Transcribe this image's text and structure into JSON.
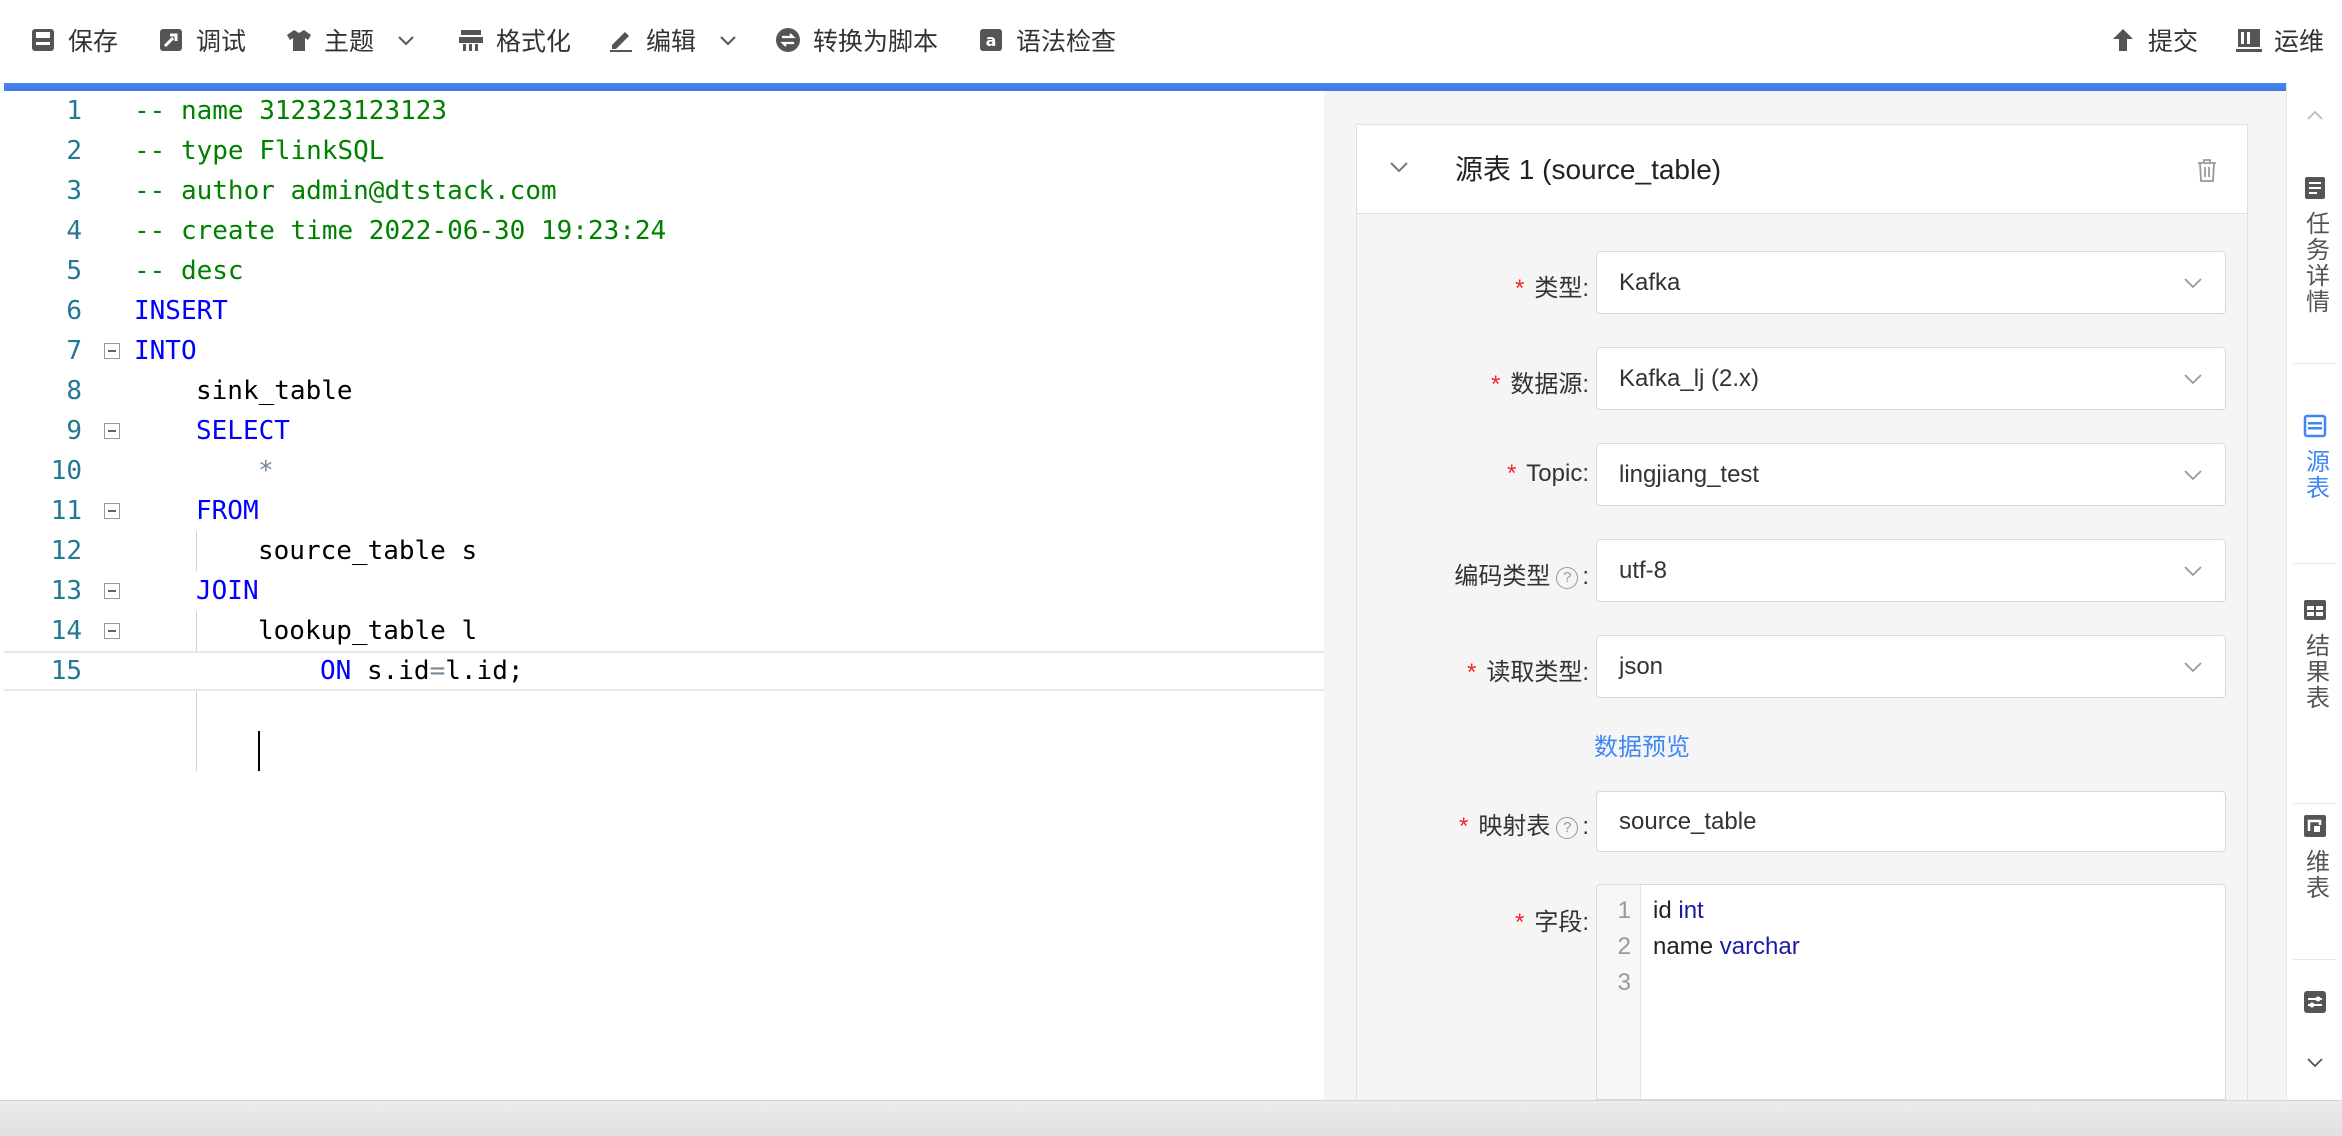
{
  "toolbar": {
    "save": "保存",
    "debug": "调试",
    "theme": "主题",
    "format": "格式化",
    "edit": "编辑",
    "convert": "转换为脚本",
    "syntax_check": "语法检查",
    "submit": "提交",
    "ops": "运维"
  },
  "editor": {
    "lines": [
      "-- name 312323123123",
      "-- type FlinkSQL",
      "-- author admin@dtstack.com",
      "-- create time 2022-06-30 19:23:24",
      "-- desc",
      "INSERT",
      "INTO",
      "sink_table",
      "SELECT",
      "*",
      "FROM",
      "source_table s",
      "JOIN",
      "lookup_table l",
      "ON",
      "s.id",
      "=",
      "l.id;"
    ],
    "line_numbers": [
      "1",
      "2",
      "3",
      "4",
      "5",
      "6",
      "7",
      "8",
      "9",
      "10",
      "11",
      "12",
      "13",
      "14",
      "15"
    ]
  },
  "source_panel": {
    "title": "源表 1 (source_table)",
    "type_label": "类型",
    "type_value": "Kafka",
    "datasource_label": "数据源",
    "datasource_value": "Kafka_lj (2.x)",
    "topic_label": "Topic",
    "topic_value": "lingjiang_test",
    "encoding_label": "编码类型",
    "encoding_value": "utf-8",
    "read_type_label": "读取类型",
    "read_type_value": "json",
    "preview_link": "数据预览",
    "mapping_label": "映射表",
    "mapping_value": "source_table",
    "fields_label": "字段",
    "fields_lines": [
      {
        "num": "1",
        "name": "id",
        "type": "int"
      },
      {
        "num": "2",
        "name": "name",
        "type": "varchar"
      },
      {
        "num": "3",
        "name": "",
        "type": ""
      }
    ],
    "colon": ":",
    "help_mark": "?"
  },
  "sidenav": {
    "task_detail": "任务详情",
    "source_table": "源表",
    "result_table": "结果表",
    "dim_table": "维表"
  },
  "colors": {
    "accent": "#3f87f5",
    "required": "#f5222d",
    "comment": "#008000",
    "keyword": "#0000ff"
  }
}
